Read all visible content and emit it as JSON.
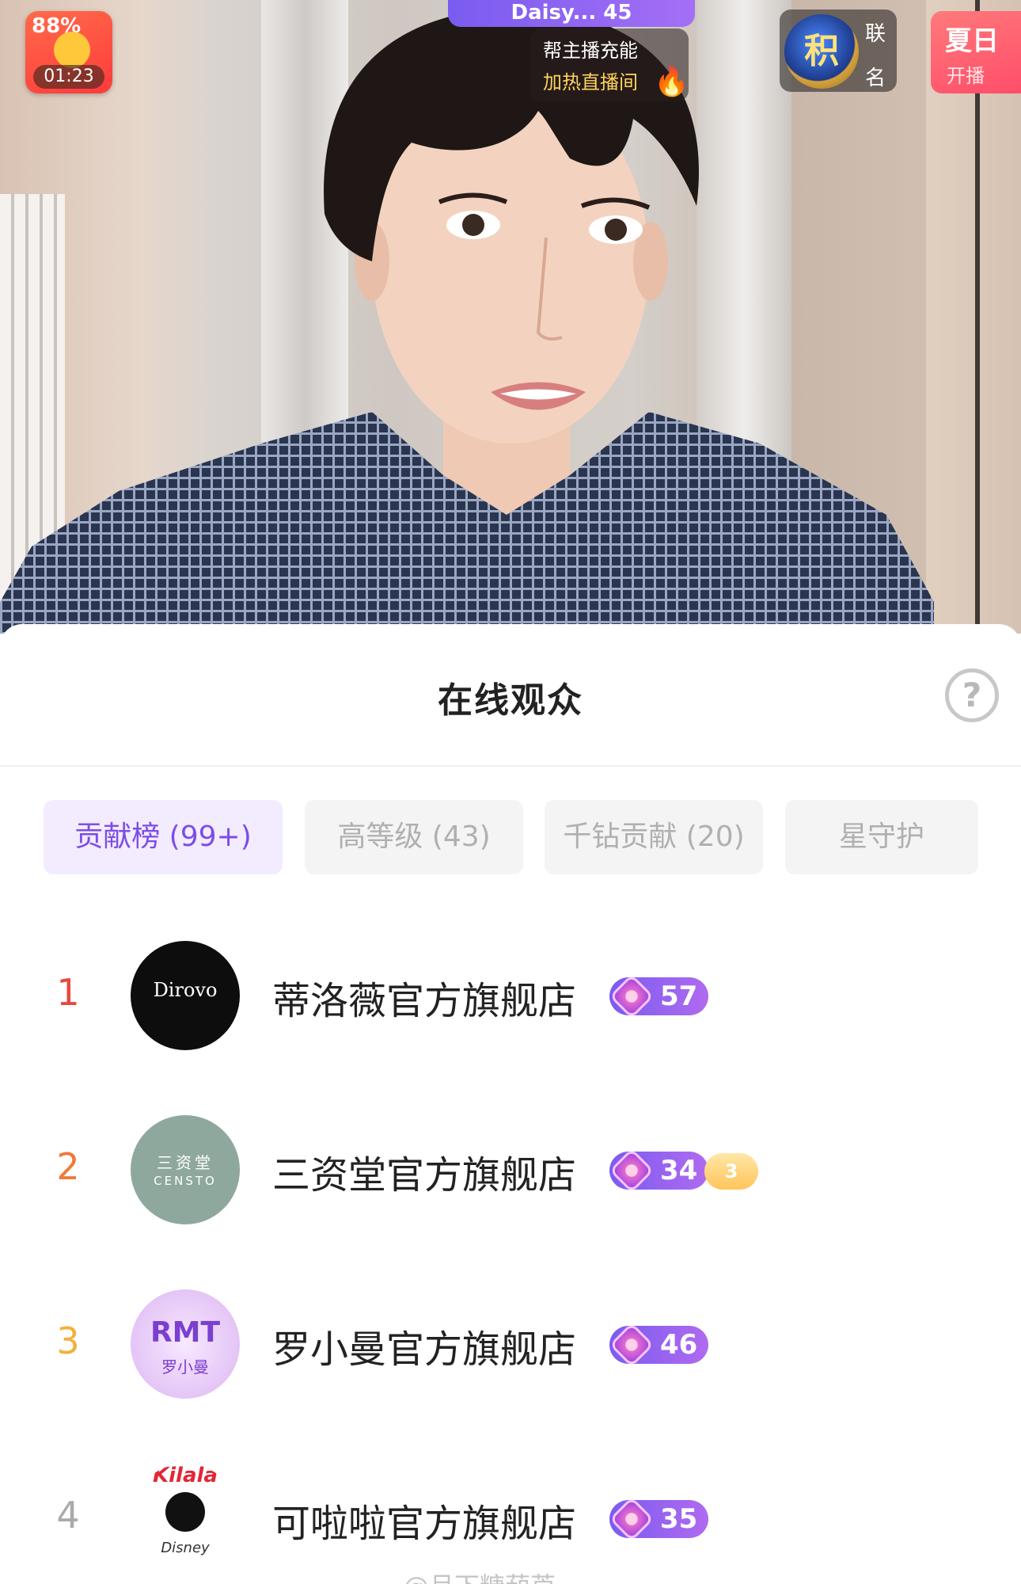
{
  "video": {
    "battery_pct": "88%",
    "timer": "01:23",
    "top_pill_text": "Daisy... 45",
    "boost_line1": "帮主播充能",
    "boost_line2": "加热直播间",
    "rank_badge_char": "积",
    "rank_label_1": "联",
    "rank_label_2": "名",
    "promo_title": "夏日",
    "promo_sub": "开播"
  },
  "sheet": {
    "title": "在线观众",
    "help": "?"
  },
  "tabs": [
    {
      "label": "贡献榜 (99+)",
      "active": true
    },
    {
      "label": "高等级 (43)",
      "active": false
    },
    {
      "label": "千钻贡献 (20)",
      "active": false
    },
    {
      "label": "星守护",
      "active": false
    }
  ],
  "viewers": [
    {
      "rank": "1",
      "name": "蒂洛薇官方旗舰店",
      "level": "57",
      "avatar_text": "Dirovo",
      "rank_color": "#e8483f"
    },
    {
      "rank": "2",
      "name": "三资堂官方旗舰店",
      "level": "34",
      "avatar_text": "三资堂",
      "avatar_sub": "CENSTO",
      "fan_level": "3",
      "rank_color": "#f07a3a"
    },
    {
      "rank": "3",
      "name": "罗小曼官方旗舰店",
      "level": "46",
      "avatar_text": "RMT",
      "avatar_sub": "罗小曼",
      "rank_color": "#f0b23a"
    },
    {
      "rank": "4",
      "name": "可啦啦官方旗舰店",
      "level": "35",
      "avatar_text": "Kilala",
      "avatar_sub": "Disney",
      "rank_color": "#aaaaaa"
    }
  ],
  "watermark": "@月下糖葫芦"
}
